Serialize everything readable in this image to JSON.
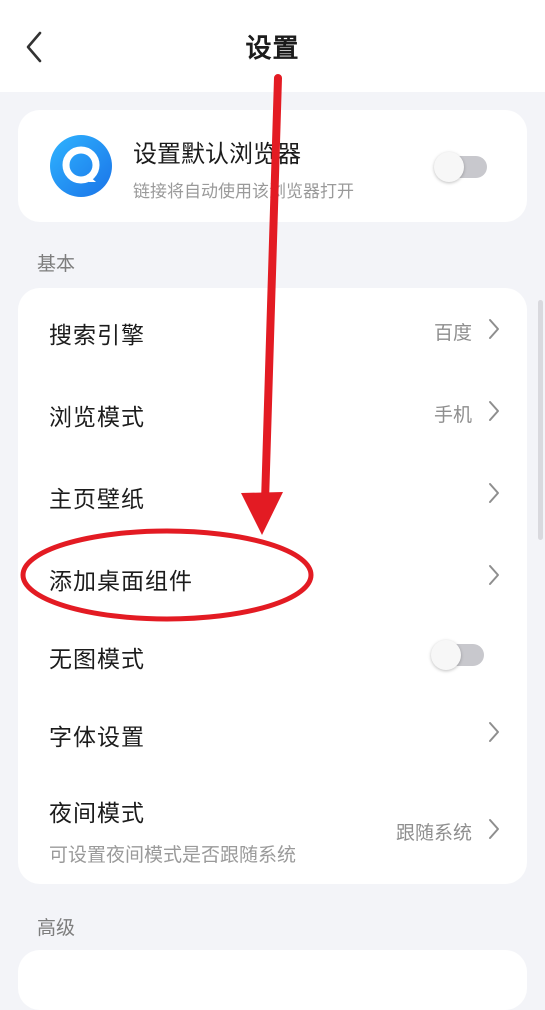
{
  "header": {
    "title": "设置",
    "back_icon": "chevron-left-icon"
  },
  "default_browser": {
    "title": "设置默认浏览器",
    "subtitle": "链接将自动使用该浏览器打开",
    "icon": "browser-logo-icon",
    "toggle_on": false
  },
  "basic": {
    "label": "基本",
    "items": [
      {
        "label": "搜索引擎",
        "value": "百度"
      },
      {
        "label": "浏览模式",
        "value": "手机"
      },
      {
        "label": "主页壁纸",
        "value": ""
      },
      {
        "label": "添加桌面组件",
        "value": ""
      },
      {
        "label": "无图模式",
        "toggle_on": false
      },
      {
        "label": "字体设置",
        "value": ""
      },
      {
        "label": "夜间模式",
        "value": "跟随系统",
        "subtitle": "可设置夜间模式是否跟随系统"
      }
    ]
  },
  "advanced": {
    "label": "高级"
  },
  "colors": {
    "annotation": "#e31b23",
    "accent": "#1e88e5"
  }
}
